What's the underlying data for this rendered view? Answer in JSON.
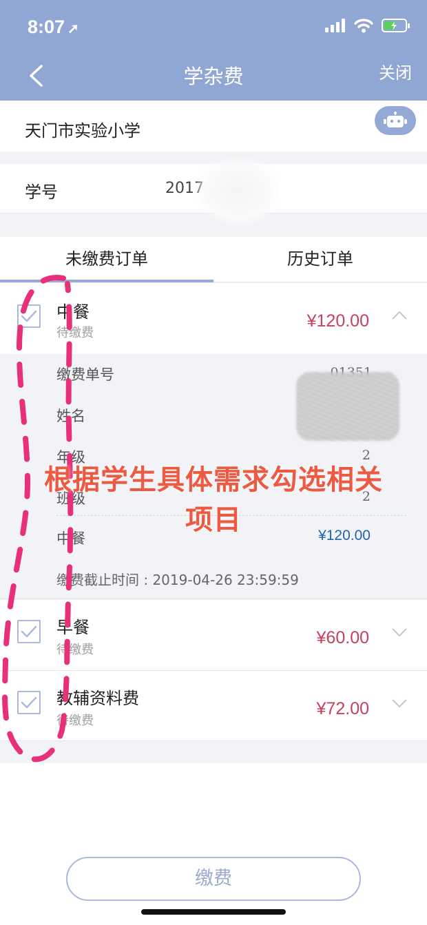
{
  "status_bar": {
    "time": "8:07"
  },
  "nav": {
    "title": "学杂费",
    "close": "关闭"
  },
  "school": {
    "name": "天门市实验小学"
  },
  "student": {
    "label": "学号",
    "id_partial": "2017"
  },
  "tabs": [
    {
      "label": "未缴费订单",
      "active": true
    },
    {
      "label": "历史订单",
      "active": false
    }
  ],
  "orders": [
    {
      "name": "中餐",
      "status": "待缴费",
      "price": "¥120.00",
      "checked": true,
      "expanded": true,
      "details": {
        "order_no_label": "缴费单号",
        "order_no_partial": "01351",
        "name_label": "姓名",
        "grade_label": "年级",
        "grade_value": "2",
        "class_label": "班级",
        "class_value": "2",
        "item_label": "中餐",
        "item_price": "¥120.00",
        "deadline": "缴费截止时间 : 2019-04-26 23:59:59"
      }
    },
    {
      "name": "早餐",
      "status": "待缴费",
      "price": "¥60.00",
      "checked": true,
      "expanded": false
    },
    {
      "name": "教辅资料费",
      "status": "待缴费",
      "price": "¥72.00",
      "checked": true,
      "expanded": false
    }
  ],
  "annotation": {
    "line1": "根据学生具体需求勾选相关",
    "line2": "项目"
  },
  "pay_button": {
    "label": "缴费"
  },
  "colors": {
    "header": "#90a6d3",
    "price": "#c8405e",
    "detail_price": "#1f64b3",
    "annotation": "#ec5a42",
    "marker": "#e8307a"
  },
  "icons": [
    "signal-icon",
    "wifi-icon",
    "battery-icon",
    "back-arrow-icon",
    "robot-icon",
    "checkbox-checked-icon",
    "chevron-up-icon",
    "chevron-down-icon"
  ]
}
